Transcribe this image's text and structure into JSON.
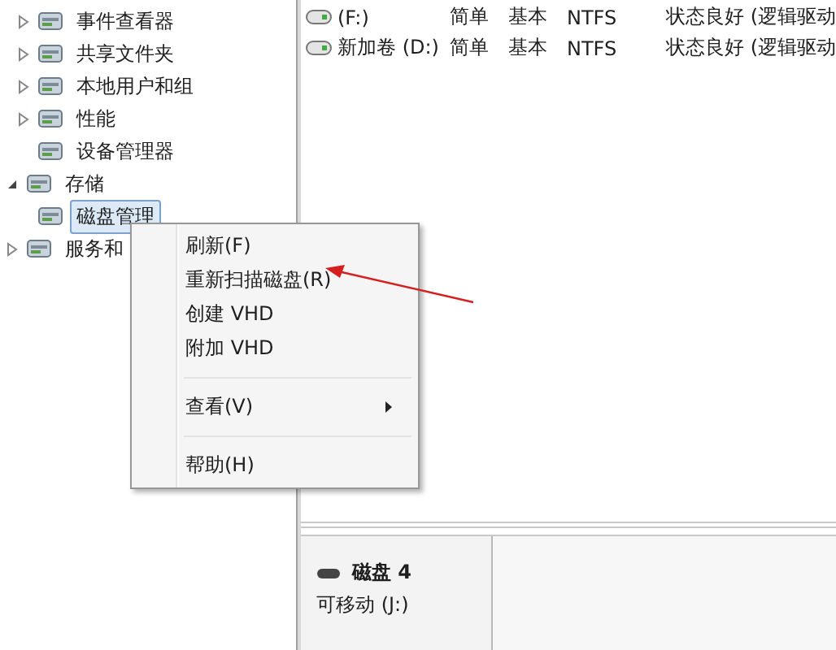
{
  "tree": [
    {
      "children": [
        {
          "label": "事件查看器",
          "expanded": false,
          "selected": false
        },
        {
          "label": "共享文件夹",
          "expanded": false,
          "selected": false
        },
        {
          "label": "本地用户和组",
          "expanded": false,
          "selected": false
        },
        {
          "label": "性能",
          "expanded": false,
          "selected": false
        },
        {
          "label": "设备管理器",
          "selected": false
        }
      ]
    },
    {
      "label": "存储",
      "expanded": true,
      "selected": false,
      "children": [
        {
          "label": "磁盘管理",
          "selected": true
        }
      ]
    },
    {
      "label": "服务和",
      "expanded": false,
      "selected": false
    }
  ],
  "volumes": [
    {
      "name": "(F:)",
      "layout": "简单",
      "type": "基本",
      "filesystem": "NTFS",
      "status": "状态良好 (逻辑驱动"
    },
    {
      "name": "新加卷 (D:)",
      "layout": "简单",
      "type": "基本",
      "filesystem": "NTFS",
      "status": "状态良好 (逻辑驱动"
    }
  ],
  "context_menu": [
    {
      "kind": "item",
      "label": "刷新(F)"
    },
    {
      "kind": "item",
      "label": "重新扫描磁盘(R)"
    },
    {
      "kind": "item",
      "label": "创建 VHD"
    },
    {
      "kind": "item",
      "label": "附加 VHD"
    },
    {
      "kind": "separator"
    },
    {
      "kind": "submenu",
      "label": "查看(V)"
    },
    {
      "kind": "separator"
    },
    {
      "kind": "item",
      "label": "帮助(H)"
    }
  ],
  "disk": {
    "name": "磁盘 4",
    "type": "可移动 (J:)"
  }
}
